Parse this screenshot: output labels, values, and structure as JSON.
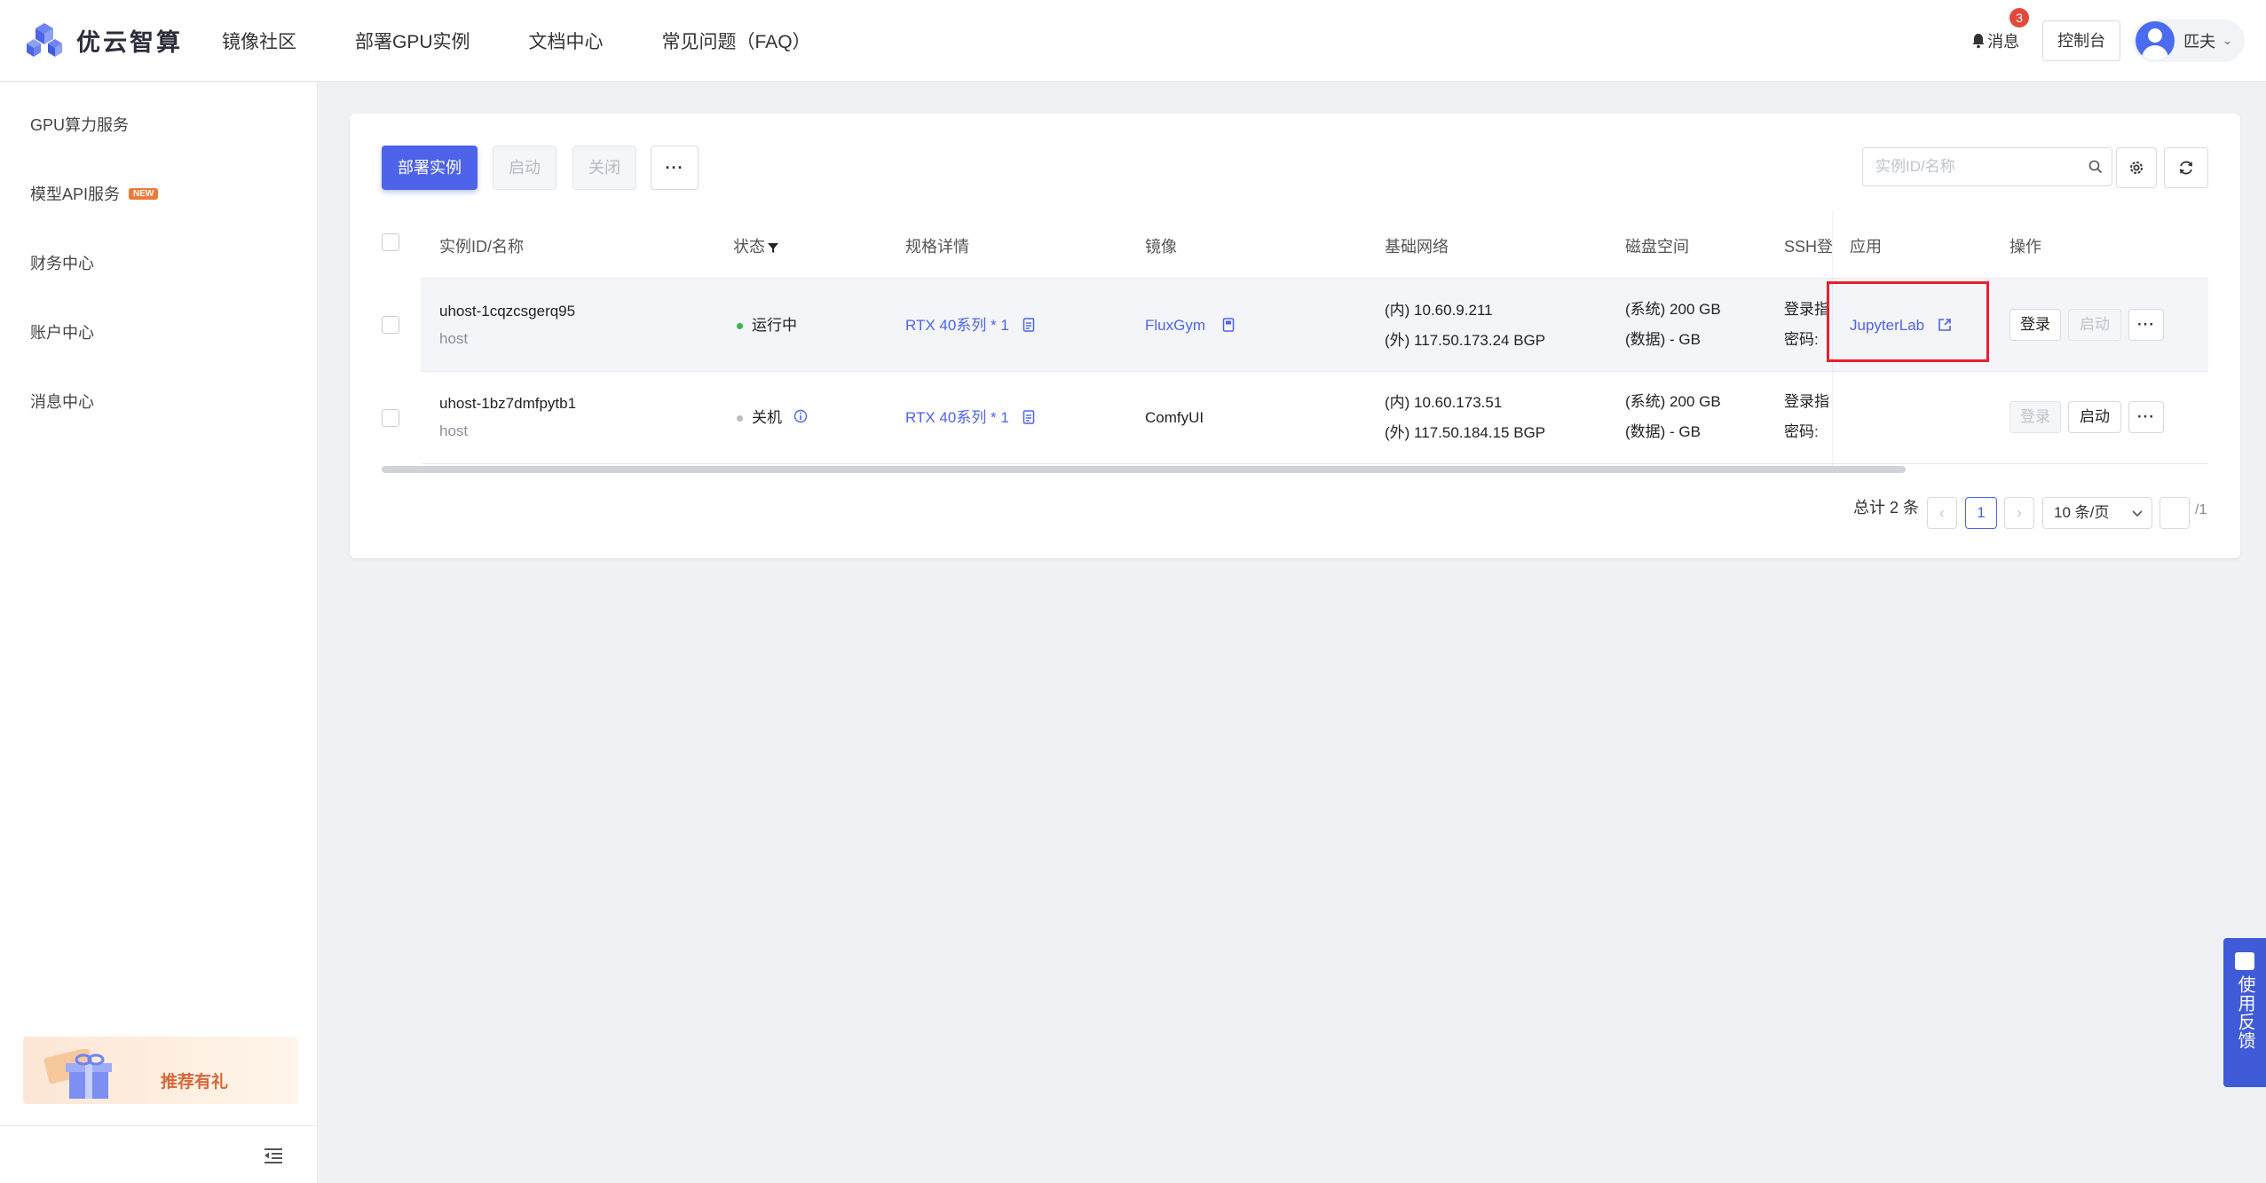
{
  "header": {
    "logo_text": "优云智算",
    "nav": [
      "镜像社区",
      "部署GPU实例",
      "文档中心",
      "常见问题（FAQ）"
    ],
    "messages_label": "消息",
    "messages_count": "3",
    "console_label": "控制台",
    "user_name": "匹夫"
  },
  "sidebar": {
    "items": [
      {
        "label": "GPU算力服务"
      },
      {
        "label": "模型API服务",
        "badge": "NEW"
      },
      {
        "label": "财务中心"
      },
      {
        "label": "账户中心"
      },
      {
        "label": "消息中心"
      }
    ],
    "promo_text": "推荐有礼"
  },
  "toolbar": {
    "deploy_label": "部署实例",
    "start_label": "启动",
    "stop_label": "关闭",
    "more_label": "···",
    "search_placeholder": "实例ID/名称"
  },
  "table": {
    "columns": [
      "实例ID/名称",
      "状态",
      "规格详情",
      "镜像",
      "基础网络",
      "磁盘空间",
      "SSH登",
      "应用",
      "操作"
    ],
    "rows": [
      {
        "id": "uhost-1cqzcsgerq95",
        "type": "host",
        "status": "运行中",
        "status_color": "#3fb34f",
        "spec": "RTX 40系列 * 1",
        "image": "FluxGym",
        "net_inner": "(内) 10.60.9.211",
        "net_outer": "(外) 117.50.173.24 BGP",
        "disk_sys": "(系统) 200 GB",
        "disk_data": "(数据) - GB",
        "ssh_line1": "登录指",
        "ssh_line2": "密码: ",
        "app": "JupyterLab",
        "op_login": "登录",
        "op_start": "启动",
        "op_more": "···"
      },
      {
        "id": "uhost-1bz7dmfpytb1",
        "type": "host",
        "status": "关机",
        "status_color": "#b9bcc4",
        "spec": "RTX 40系列 * 1",
        "image": "ComfyUI",
        "net_inner": "(内) 10.60.173.51",
        "net_outer": "(外) 117.50.184.15 BGP",
        "disk_sys": "(系统) 200 GB",
        "disk_data": "(数据) - GB",
        "ssh_line1": "登录指",
        "ssh_line2": "密码: ",
        "app": "",
        "op_login": "登录",
        "op_start": "启动",
        "op_more": "···"
      }
    ]
  },
  "pagination": {
    "total_label": "总计 2 条",
    "prev": "‹",
    "current_page": "1",
    "next": "›",
    "page_size": "10 条/页",
    "total_pages": "/1"
  },
  "feedback_label": "使用反馈",
  "colors": {
    "primary": "#4e63e9",
    "running": "#3fb34f",
    "stopped": "#b9bcc4",
    "highlight": "#e8202a"
  }
}
